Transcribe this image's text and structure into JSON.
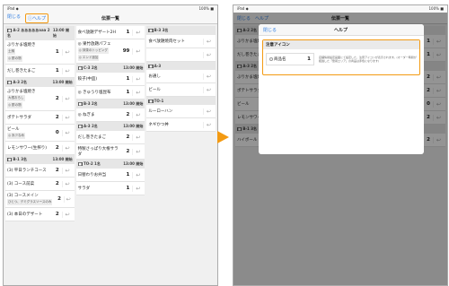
{
  "status_left": "iPad ◆",
  "status_right": "100% ■",
  "nav": {
    "close": "閉じる",
    "help": "ヘルプ",
    "title": "伝票一覧"
  },
  "columns": [
    [
      {
        "type": "header",
        "label": "A-2 あああああaaa",
        "badge": "2名",
        "time": "13:00 開始"
      },
      {
        "type": "item",
        "name": "ぶりかま塩焼き",
        "tags": [
          "土鍋",
          "◎ 酢の物"
        ],
        "qty": "1"
      },
      {
        "type": "item",
        "name": "だし巻きたまご",
        "tags": [],
        "qty": "1"
      },
      {
        "type": "header",
        "label": "A-3",
        "badge": "2名",
        "time": "13:00 開始"
      },
      {
        "type": "item",
        "name": "ぶりかま塩焼き",
        "tags": [
          "大根おろし",
          "◎ 酢の物"
        ],
        "qty": "2"
      },
      {
        "type": "item",
        "name": "ポテトサラダ",
        "tags": [],
        "qty": "2"
      },
      {
        "type": "item",
        "name": "ビール",
        "tags": [
          "◎ 氷少なめ"
        ],
        "qty": "0"
      },
      {
        "type": "item",
        "name": "レモンサワー(生搾り)",
        "tags": [],
        "qty": "2"
      },
      {
        "type": "header",
        "label": "B-1",
        "badge": "3名",
        "time": "13:00 開始"
      },
      {
        "type": "item",
        "name": "(3) 平日ランチコース",
        "tags": [],
        "qty": "2"
      },
      {
        "type": "item",
        "name": "(3) コース前菜",
        "tags": [],
        "qty": "2"
      },
      {
        "type": "item",
        "name": "(3) コースメイン",
        "tags": [
          "ひとつ、デミグラスソースのみ"
        ],
        "qty": "2"
      },
      {
        "type": "item",
        "name": "(3) 本日のデザート",
        "tags": [],
        "qty": "2"
      }
    ],
    [
      {
        "type": "item",
        "name": "食べ放題デザート2H",
        "tags": [],
        "qty": "1"
      },
      {
        "type": "item",
        "name": "◎ 果竹放題パフェ",
        "tags": [
          "◎ 抹茶のトッピング",
          "◎ エンド追加"
        ],
        "qty": "99"
      },
      {
        "type": "header",
        "label": "C-3",
        "badge": "2名",
        "time": "13:00 開始"
      },
      {
        "type": "item",
        "name": "餃子(中皿)",
        "tags": [],
        "qty": "1"
      },
      {
        "type": "item",
        "name": "◎ きゅうり塩昆布",
        "tags": [],
        "qty": "1"
      },
      {
        "type": "header",
        "label": "B-3",
        "badge": "2名",
        "time": "13:00 開始"
      },
      {
        "type": "item",
        "name": "◎ ねぎま",
        "tags": [],
        "qty": "2"
      },
      {
        "type": "header",
        "label": "A-3",
        "badge": "2名",
        "time": "13:00 開始"
      },
      {
        "type": "item",
        "name": "だし巻きたまご",
        "tags": [],
        "qty": "2"
      },
      {
        "type": "item",
        "name": "特製さっぱり大根サラダ",
        "tags": [],
        "qty": "2"
      },
      {
        "type": "header",
        "label": "TO-2",
        "badge": "1名",
        "time": "13:00 開始"
      },
      {
        "type": "item",
        "name": "日替わりお弁当",
        "tags": [],
        "qty": "1"
      },
      {
        "type": "item",
        "name": "サラダ",
        "tags": [],
        "qty": "1"
      }
    ],
    [
      {
        "type": "header",
        "label": "B-3",
        "badge": "3名",
        "time": ""
      },
      {
        "type": "item",
        "name": "食べ放題焼肉セット",
        "tags": [],
        "qty": ""
      },
      {
        "type": "item",
        "name": "",
        "tags": [],
        "qty": ""
      },
      {
        "type": "header",
        "label": "A-3",
        "badge": "",
        "time": ""
      },
      {
        "type": "item",
        "name": "お通し",
        "tags": [],
        "qty": ""
      },
      {
        "type": "item",
        "name": "ビール",
        "tags": [],
        "qty": ""
      },
      {
        "type": "header",
        "label": "TO-1",
        "badge": "",
        "time": ""
      },
      {
        "type": "item",
        "name": "ルーローハン",
        "tags": [],
        "qty": ""
      },
      {
        "type": "item",
        "name": "ネギかつ丼",
        "tags": [],
        "qty": ""
      }
    ]
  ],
  "right_partial": [
    {
      "type": "header",
      "label": "A-2",
      "badge": "2名",
      "time": ""
    },
    {
      "type": "item",
      "name": "ぶりかま塩焼き",
      "tags": [],
      "qty": "1"
    },
    {
      "type": "item",
      "name": "だし巻きたまご",
      "tags": [],
      "qty": "1"
    },
    {
      "type": "header",
      "label": "A-3",
      "badge": "2名",
      "time": ""
    },
    {
      "type": "item",
      "name": "ぶりかま塩焼き",
      "tags": [],
      "qty": "2"
    },
    {
      "type": "item",
      "name": "ポテトサラダ",
      "tags": [],
      "qty": "2"
    },
    {
      "type": "item",
      "name": "ビール",
      "tags": [],
      "qty": "0"
    },
    {
      "type": "item",
      "name": "レモンサワー",
      "tags": [],
      "qty": "2"
    },
    {
      "type": "header",
      "label": "B-1",
      "badge": "3名",
      "time": ""
    },
    {
      "type": "item",
      "name": "ハイボール",
      "tags": [],
      "qty": "2"
    }
  ],
  "modal": {
    "close": "閉じる",
    "title": "ヘルプ",
    "section": "注意アイコン",
    "card_label": "商品名",
    "card_qty": "1",
    "desc": "店舗情報設定画面にて設定した、注意アイコンが表示されます。(オーダー時間が経過した「警報エリア」の商品は赤色になります)"
  },
  "colors": {
    "accent": "#f39a12",
    "link": "#2f7de1",
    "dim": "rgba(0,0,0,0.42)"
  }
}
